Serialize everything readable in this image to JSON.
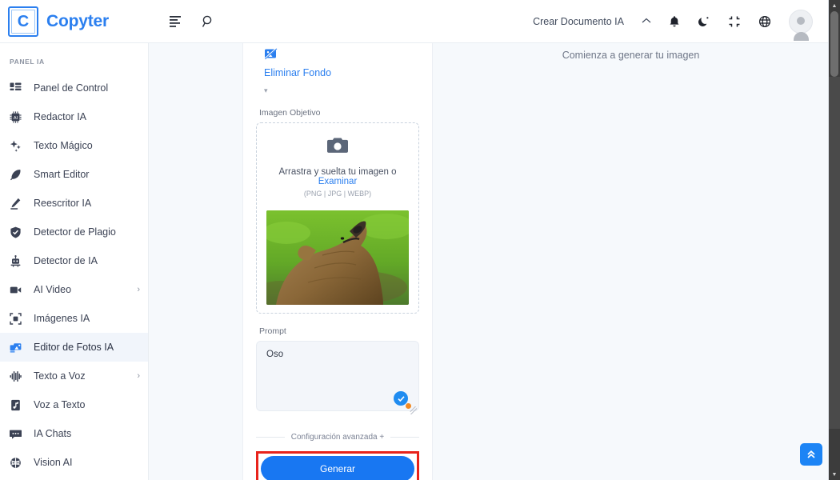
{
  "header": {
    "logo_letter": "C",
    "brand": "Copyter",
    "menu_icon": "menu-lines-icon",
    "search_icon": "search-icon",
    "create_doc_label": "Crear Documento IA",
    "caret": "ⱏ",
    "notifications_icon": "bell-icon",
    "theme_icon": "moon-icon",
    "fullscreen_icon": "compress-icon",
    "language_icon": "globe-icon",
    "avatar": "user-avatar"
  },
  "sidebar": {
    "section_label": "PANEL IA",
    "items": [
      {
        "label": "Panel de Control",
        "icon": "dashboard-icon",
        "active": false,
        "chevron": ""
      },
      {
        "label": "Redactor IA",
        "icon": "chip-ai-icon",
        "active": false,
        "chevron": ""
      },
      {
        "label": "Texto Mágico",
        "icon": "sparkles-icon",
        "active": false,
        "chevron": ""
      },
      {
        "label": "Smart Editor",
        "icon": "feather-icon",
        "active": false,
        "chevron": ""
      },
      {
        "label": "Reescritor IA",
        "icon": "pencil-icon",
        "active": false,
        "chevron": ""
      },
      {
        "label": "Detector de Plagio",
        "icon": "shield-check-icon",
        "active": false,
        "chevron": ""
      },
      {
        "label": "Detector de IA",
        "icon": "robot-icon",
        "active": false,
        "chevron": ""
      },
      {
        "label": "AI Video",
        "icon": "video-camera-icon",
        "active": false,
        "chevron": "›"
      },
      {
        "label": "Imágenes IA",
        "icon": "image-frame-icon",
        "active": false,
        "chevron": ""
      },
      {
        "label": "Editor de Fotos IA",
        "icon": "photo-editor-icon",
        "active": true,
        "chevron": ""
      },
      {
        "label": "Texto a Voz",
        "icon": "waveform-icon",
        "active": false,
        "chevron": "›"
      },
      {
        "label": "Voz a Texto",
        "icon": "audio-file-icon",
        "active": false,
        "chevron": ""
      },
      {
        "label": "IA Chats",
        "icon": "chat-bubble-icon",
        "active": false,
        "chevron": ""
      },
      {
        "label": "Vision AI",
        "icon": "brain-icon",
        "active": false,
        "chevron": ""
      }
    ]
  },
  "form": {
    "tool_icon": "image-slash-icon",
    "tool_name": "Eliminar Fondo",
    "tool_chevron": "▾",
    "target_image_label": "Imagen Objetivo",
    "dropzone": {
      "camera_icon": "camera-icon",
      "text_prefix": "Arrastra y suelta tu imagen o ",
      "browse_link": "Examinar",
      "formats": "(PNG | JPG | WEBP)"
    },
    "thumbnail_alt": "bear-photo-thumbnail",
    "prompt_label": "Prompt",
    "prompt_value": "Oso",
    "prompt_placeholder": "",
    "prompt_badge_icon": "check-circle-icon",
    "advanced_label": "Configuración avanzada +",
    "generate_label": "Generar",
    "highlight_color": "#e8231b"
  },
  "preview": {
    "empty_text": "Comienza a generar tu imagen"
  },
  "floating": {
    "scroll_top_icon": "double-chevron-up-icon",
    "scroll_top_glyph": "»"
  },
  "colors": {
    "brand_blue": "#2b7fef",
    "button_blue": "#1877f2",
    "panel_bg": "#f6f9fc",
    "highlight_red": "#e8231b"
  }
}
